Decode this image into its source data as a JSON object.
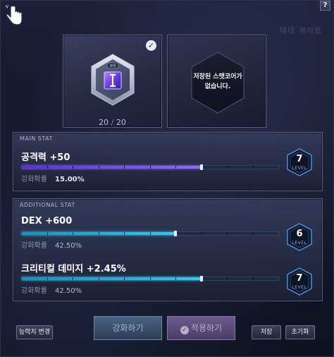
{
  "window": {
    "help_label": "?",
    "bg_deco_text": "애테 게이트"
  },
  "core_slot": {
    "count": "20",
    "separator": "/",
    "max": "20",
    "badge_text": "코어"
  },
  "empty_slot": {
    "message_line1": "저장된 스탯코어가",
    "message_line2": "없습니다."
  },
  "main_stat": {
    "section_title": "MAIN STAT",
    "name": "공격력 +50",
    "rate_label": "강화확률",
    "rate_value": "15.00%",
    "level": "7",
    "level_label": "LEVEL",
    "progress": 0.7
  },
  "additional_stat": {
    "section_title": "ADDITIONAL STAT",
    "stats": [
      {
        "name": "DEX +600",
        "rate_label": "강화확률",
        "rate_value": "42.50%",
        "level": "6",
        "level_label": "LEVEL",
        "progress": 0.6
      },
      {
        "name": "크리티컬 데미지 +2.45%",
        "rate_label": "강화확률",
        "rate_value": "42.50%",
        "level": "7",
        "level_label": "LEVEL",
        "progress": 0.7
      }
    ]
  },
  "buttons": {
    "change_stat": "능력치 변경",
    "enhance": "강화하기",
    "apply": "적용하기",
    "save": "저장",
    "reset": "초기화"
  },
  "colors": {
    "main_bar": "#7a58ea",
    "additional_bar": "#2fb4e0",
    "accent_level": "#4a8fe0"
  }
}
